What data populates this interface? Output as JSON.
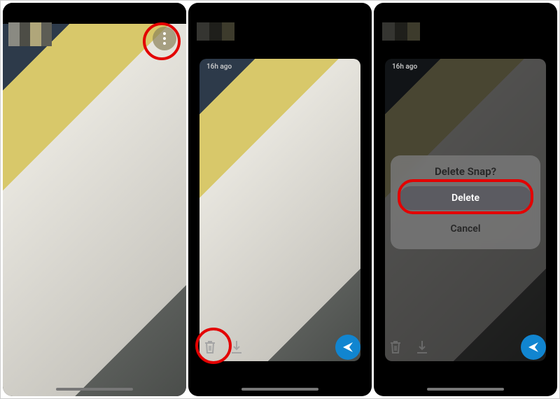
{
  "panel2": {
    "timestamp": "16h ago"
  },
  "panel3": {
    "timestamp": "16h ago",
    "dialog": {
      "title": "Delete Snap?",
      "delete_label": "Delete",
      "cancel_label": "Cancel"
    }
  }
}
